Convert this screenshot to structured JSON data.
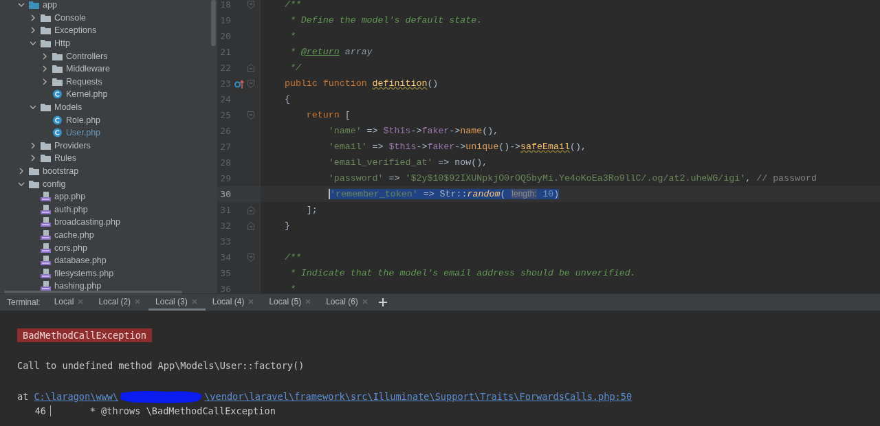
{
  "project_tree": [
    {
      "label": "app",
      "kind": "folder",
      "expanded": true,
      "children": [
        {
          "label": "Console",
          "kind": "folder",
          "expanded": false
        },
        {
          "label": "Exceptions",
          "kind": "folder",
          "expanded": false
        },
        {
          "label": "Http",
          "kind": "folder",
          "expanded": true,
          "children": [
            {
              "label": "Controllers",
              "kind": "folder",
              "expanded": false
            },
            {
              "label": "Middleware",
              "kind": "folder",
              "expanded": false
            },
            {
              "label": "Requests",
              "kind": "folder",
              "expanded": false
            },
            {
              "label": "Kernel.php",
              "kind": "class",
              "modified": false
            }
          ]
        },
        {
          "label": "Models",
          "kind": "folder",
          "expanded": true,
          "children": [
            {
              "label": "Role.php",
              "kind": "class",
              "modified": false
            },
            {
              "label": "User.php",
              "kind": "class",
              "modified": true
            }
          ]
        },
        {
          "label": "Providers",
          "kind": "folder",
          "expanded": false
        },
        {
          "label": "Rules",
          "kind": "folder",
          "expanded": false
        }
      ]
    },
    {
      "label": "bootstrap",
      "kind": "folder",
      "expanded": false
    },
    {
      "label": "config",
      "kind": "folder",
      "expanded": true,
      "children": [
        {
          "label": "app.php",
          "kind": "php",
          "modified": false
        },
        {
          "label": "auth.php",
          "kind": "php",
          "modified": false
        },
        {
          "label": "broadcasting.php",
          "kind": "php",
          "modified": false
        },
        {
          "label": "cache.php",
          "kind": "php",
          "modified": false
        },
        {
          "label": "cors.php",
          "kind": "php",
          "modified": false
        },
        {
          "label": "database.php",
          "kind": "php",
          "modified": false
        },
        {
          "label": "filesystems.php",
          "kind": "php",
          "modified": false
        },
        {
          "label": "hashing.php",
          "kind": "php",
          "modified": false
        }
      ]
    }
  ],
  "editor": {
    "lines": [
      {
        "number": "18",
        "fold_start": true,
        "selected": false,
        "tokens": [
          {
            "text": "    /**",
            "kind": "comment"
          }
        ]
      },
      {
        "number": "19",
        "selected": false,
        "tokens": [
          {
            "text": "     * Define the model's default state.",
            "kind": "comment"
          }
        ]
      },
      {
        "number": "20",
        "selected": false,
        "tokens": [
          {
            "text": "     *",
            "kind": "comment"
          }
        ]
      },
      {
        "number": "21",
        "selected": false,
        "tokens": [
          {
            "text": "     * ",
            "kind": "comment"
          },
          {
            "text": "@return",
            "kind": "doctag"
          },
          {
            "text": " array",
            "kind": "doctype"
          }
        ]
      },
      {
        "number": "22",
        "fold_end": true,
        "selected": false,
        "tokens": [
          {
            "text": "     */",
            "kind": "comment"
          }
        ]
      },
      {
        "number": "23",
        "fold_start": true,
        "override_marker": true,
        "selected": false,
        "tokens": [
          {
            "text": "    public function ",
            "kind": "keyword"
          },
          {
            "text": "definition",
            "kind": "funcdef"
          },
          {
            "text": "()",
            "kind": "plain"
          }
        ]
      },
      {
        "number": "24",
        "selected": false,
        "tokens": [
          {
            "text": "    {",
            "kind": "plain"
          }
        ]
      },
      {
        "number": "25",
        "fold_start": true,
        "selected": false,
        "tokens": [
          {
            "text": "        return ",
            "kind": "keyword"
          },
          {
            "text": "[",
            "kind": "plain"
          }
        ]
      },
      {
        "number": "26",
        "selected": false,
        "tokens": [
          {
            "text": "            'name'",
            "kind": "string"
          },
          {
            "text": " => ",
            "kind": "plain"
          },
          {
            "text": "$this",
            "kind": "var"
          },
          {
            "text": "->",
            "kind": "plain"
          },
          {
            "text": "faker",
            "kind": "var"
          },
          {
            "text": "->",
            "kind": "plain"
          },
          {
            "text": "name",
            "kind": "method"
          },
          {
            "text": "(),",
            "kind": "plain"
          }
        ]
      },
      {
        "number": "27",
        "selected": false,
        "tokens": [
          {
            "text": "            'email'",
            "kind": "string"
          },
          {
            "text": " => ",
            "kind": "plain"
          },
          {
            "text": "$this",
            "kind": "var"
          },
          {
            "text": "->",
            "kind": "plain"
          },
          {
            "text": "faker",
            "kind": "var"
          },
          {
            "text": "->",
            "kind": "plain"
          },
          {
            "text": "unique",
            "kind": "method"
          },
          {
            "text": "()->",
            "kind": "plain"
          },
          {
            "text": "safeEmail",
            "kind": "funcdef"
          },
          {
            "text": "(),",
            "kind": "plain"
          }
        ]
      },
      {
        "number": "28",
        "selected": false,
        "tokens": [
          {
            "text": "            'email_verified_at'",
            "kind": "string"
          },
          {
            "text": " => now(),",
            "kind": "plain"
          }
        ]
      },
      {
        "number": "29",
        "selected": false,
        "tokens": [
          {
            "text": "            'password'",
            "kind": "string"
          },
          {
            "text": " => ",
            "kind": "plain"
          },
          {
            "text": "'$2y$10$92IXUNpkjO0rOQ5byMi.Ye4oKoEa3Ro9llC/.og/at2.uheWG/igi'",
            "kind": "string"
          },
          {
            "text": ", ",
            "kind": "plain"
          },
          {
            "text": "// password",
            "kind": "linecomment"
          }
        ]
      },
      {
        "number": "30",
        "selected": true,
        "tokens": [
          {
            "text": "'remember_token'",
            "kind": "string"
          },
          {
            "text": " => Str::",
            "kind": "plain"
          },
          {
            "text": "random",
            "kind": "static"
          },
          {
            "text": "( ",
            "kind": "plain"
          },
          {
            "text": "length:",
            "kind": "hint"
          },
          {
            "text": " 10",
            "kind": "number"
          },
          {
            "text": ")",
            "kind": "plain"
          }
        ]
      },
      {
        "number": "31",
        "fold_end": true,
        "selected": false,
        "tokens": [
          {
            "text": "        ];",
            "kind": "plain"
          }
        ]
      },
      {
        "number": "32",
        "fold_end": true,
        "selected": false,
        "tokens": [
          {
            "text": "    }",
            "kind": "plain"
          }
        ]
      },
      {
        "number": "33",
        "selected": false
      },
      {
        "number": "34",
        "fold_start": true,
        "selected": false,
        "tokens": [
          {
            "text": "    /**",
            "kind": "comment"
          }
        ]
      },
      {
        "number": "35",
        "selected": false,
        "tokens": [
          {
            "text": "     * Indicate that the model's email address should be unverified.",
            "kind": "comment"
          }
        ]
      },
      {
        "number": "36",
        "selected": false,
        "tokens": [
          {
            "text": "     *",
            "kind": "comment"
          }
        ]
      }
    ]
  },
  "terminal": {
    "label": "Terminal:",
    "tabs": [
      {
        "label": "Local",
        "selected": false
      },
      {
        "label": "Local (2)",
        "selected": false
      },
      {
        "label": "Local (3)",
        "selected": true
      },
      {
        "label": "Local (4)",
        "selected": false
      },
      {
        "label": "Local (5)",
        "selected": false
      },
      {
        "label": "Local (6)",
        "selected": false
      }
    ],
    "exception": "BadMethodCallException",
    "message": "Call to undefined method App\\Models\\User::factory()",
    "at": "at",
    "path_start": "C:\\laragon\\www\\",
    "path_end": "\\vendor\\laravel\\framework\\src\\Illuminate\\Support\\Traits\\ForwardsCalls.php:50",
    "snippet_line": "46",
    "snippet_code": "    * @throws \\BadMethodCallException"
  }
}
